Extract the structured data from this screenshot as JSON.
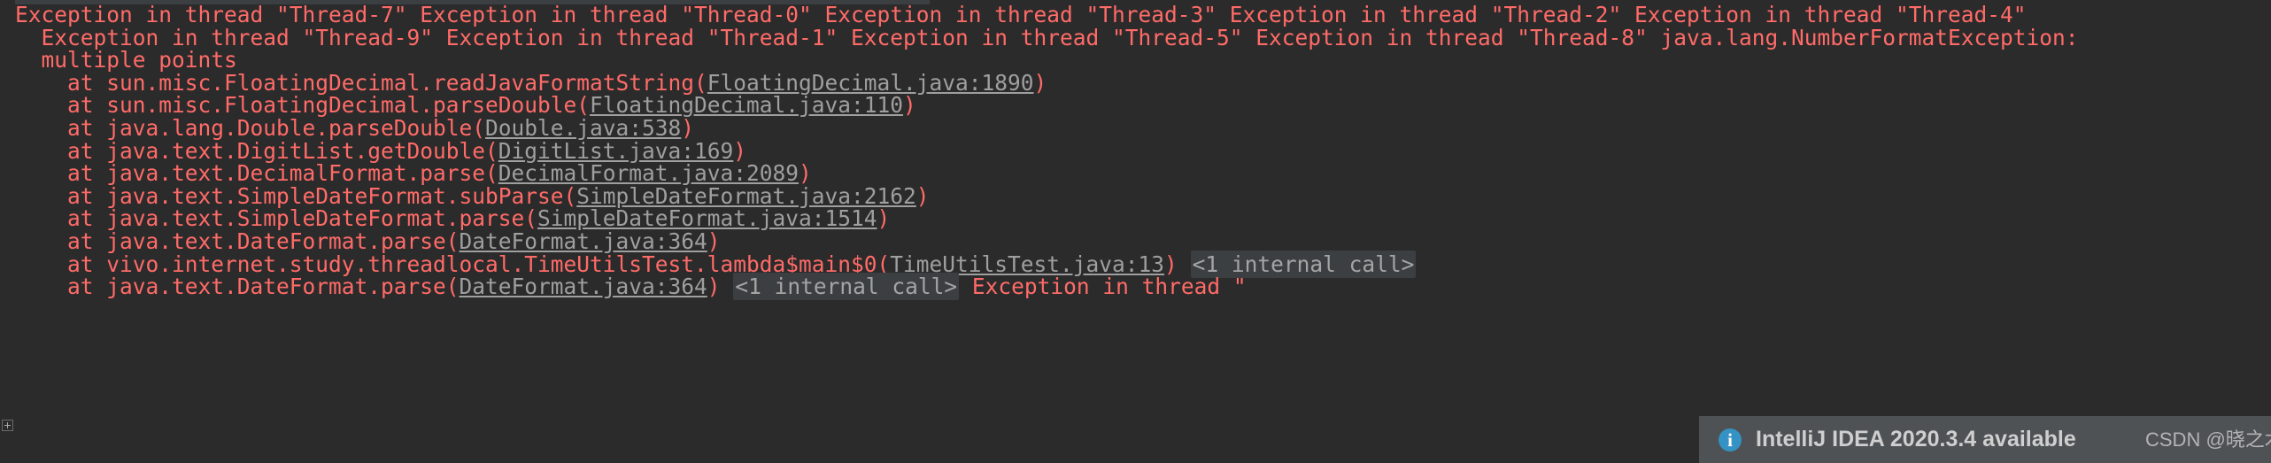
{
  "window": {
    "background_color": "#2b2b2b",
    "error_color": "#ff6b68",
    "link_color": "#9f9f9f",
    "accent_color": "#3592c4"
  },
  "console": {
    "lines": [
      {
        "id": "exception-header-line-1",
        "indent": 0,
        "segments": [
          {
            "kind": "error",
            "text": "Exception in thread \"Thread-7\" Exception in thread \"Thread-0\" Exception in thread \"Thread-3\" Exception in thread \"Thread-2\" Exception in thread \"Thread-4\""
          }
        ]
      },
      {
        "id": "exception-header-line-2",
        "indent": 1,
        "segments": [
          {
            "kind": "error",
            "text": "Exception in thread \"Thread-9\" Exception in thread \"Thread-1\" Exception in thread \"Thread-5\" Exception in thread \"Thread-8\" java.lang.NumberFormatException:"
          }
        ]
      },
      {
        "id": "exception-message-line",
        "indent": 1,
        "segments": [
          {
            "kind": "error",
            "text": "multiple points"
          }
        ]
      },
      {
        "id": "stack-frame-1",
        "indent": 2,
        "segments": [
          {
            "kind": "error",
            "text": "at sun.misc.FloatingDecimal.readJavaFormatString("
          },
          {
            "kind": "link",
            "text": "FloatingDecimal.java:1890"
          },
          {
            "kind": "error",
            "text": ")"
          }
        ]
      },
      {
        "id": "stack-frame-2",
        "indent": 2,
        "segments": [
          {
            "kind": "error",
            "text": "at sun.misc.FloatingDecimal.parseDouble("
          },
          {
            "kind": "link",
            "text": "FloatingDecimal.java:110"
          },
          {
            "kind": "error",
            "text": ")"
          }
        ]
      },
      {
        "id": "stack-frame-3",
        "indent": 2,
        "segments": [
          {
            "kind": "error",
            "text": "at java.lang.Double.parseDouble("
          },
          {
            "kind": "link",
            "text": "Double.java:538"
          },
          {
            "kind": "error",
            "text": ")"
          }
        ]
      },
      {
        "id": "stack-frame-4",
        "indent": 2,
        "segments": [
          {
            "kind": "error",
            "text": "at java.text.DigitList.getDouble("
          },
          {
            "kind": "link",
            "text": "DigitList.java:169"
          },
          {
            "kind": "error",
            "text": ")"
          }
        ]
      },
      {
        "id": "stack-frame-5",
        "indent": 2,
        "segments": [
          {
            "kind": "error",
            "text": "at java.text.DecimalFormat.parse("
          },
          {
            "kind": "link",
            "text": "DecimalFormat.java:2089"
          },
          {
            "kind": "error",
            "text": ")"
          }
        ]
      },
      {
        "id": "stack-frame-6",
        "indent": 2,
        "segments": [
          {
            "kind": "error",
            "text": "at java.text.SimpleDateFormat.subParse("
          },
          {
            "kind": "link",
            "text": "SimpleDateFormat.java:2162"
          },
          {
            "kind": "error",
            "text": ")"
          }
        ]
      },
      {
        "id": "stack-frame-7",
        "indent": 2,
        "segments": [
          {
            "kind": "error",
            "text": "at java.text.SimpleDateFormat.parse("
          },
          {
            "kind": "link",
            "text": "SimpleDateFormat.java:1514"
          },
          {
            "kind": "error",
            "text": ")"
          }
        ]
      },
      {
        "id": "stack-frame-8",
        "indent": 2,
        "segments": [
          {
            "kind": "error",
            "text": "at java.text.DateFormat.parse("
          },
          {
            "kind": "link",
            "text": "DateFormat.java:364"
          },
          {
            "kind": "error",
            "text": ")"
          }
        ]
      },
      {
        "id": "stack-frame-9",
        "indent": 2,
        "segments": [
          {
            "kind": "error",
            "text": "at vivo.internet.study.threadlocal.TimeUtilsTest.lambda$main$0("
          },
          {
            "kind": "link",
            "text": "TimeUtilsTest.java:13"
          },
          {
            "kind": "error",
            "text": ") "
          },
          {
            "kind": "internal",
            "text": "<1 internal call>"
          }
        ]
      },
      {
        "id": "stack-frame-10-clipped",
        "indent": 2,
        "segments": [
          {
            "kind": "error",
            "text": "at java.text.DateFormat.parse("
          },
          {
            "kind": "link",
            "text": "DateFormat.java:364"
          },
          {
            "kind": "error",
            "text": ") "
          },
          {
            "kind": "internal",
            "text": "<1 internal call>"
          },
          {
            "kind": "error",
            "text": " Exception in thread \""
          }
        ]
      }
    ]
  },
  "notification": {
    "icon": "info-icon",
    "message": "IntelliJ IDEA 2020.3.4 available"
  },
  "watermark": {
    "text": "CSDN @晓之木初"
  }
}
